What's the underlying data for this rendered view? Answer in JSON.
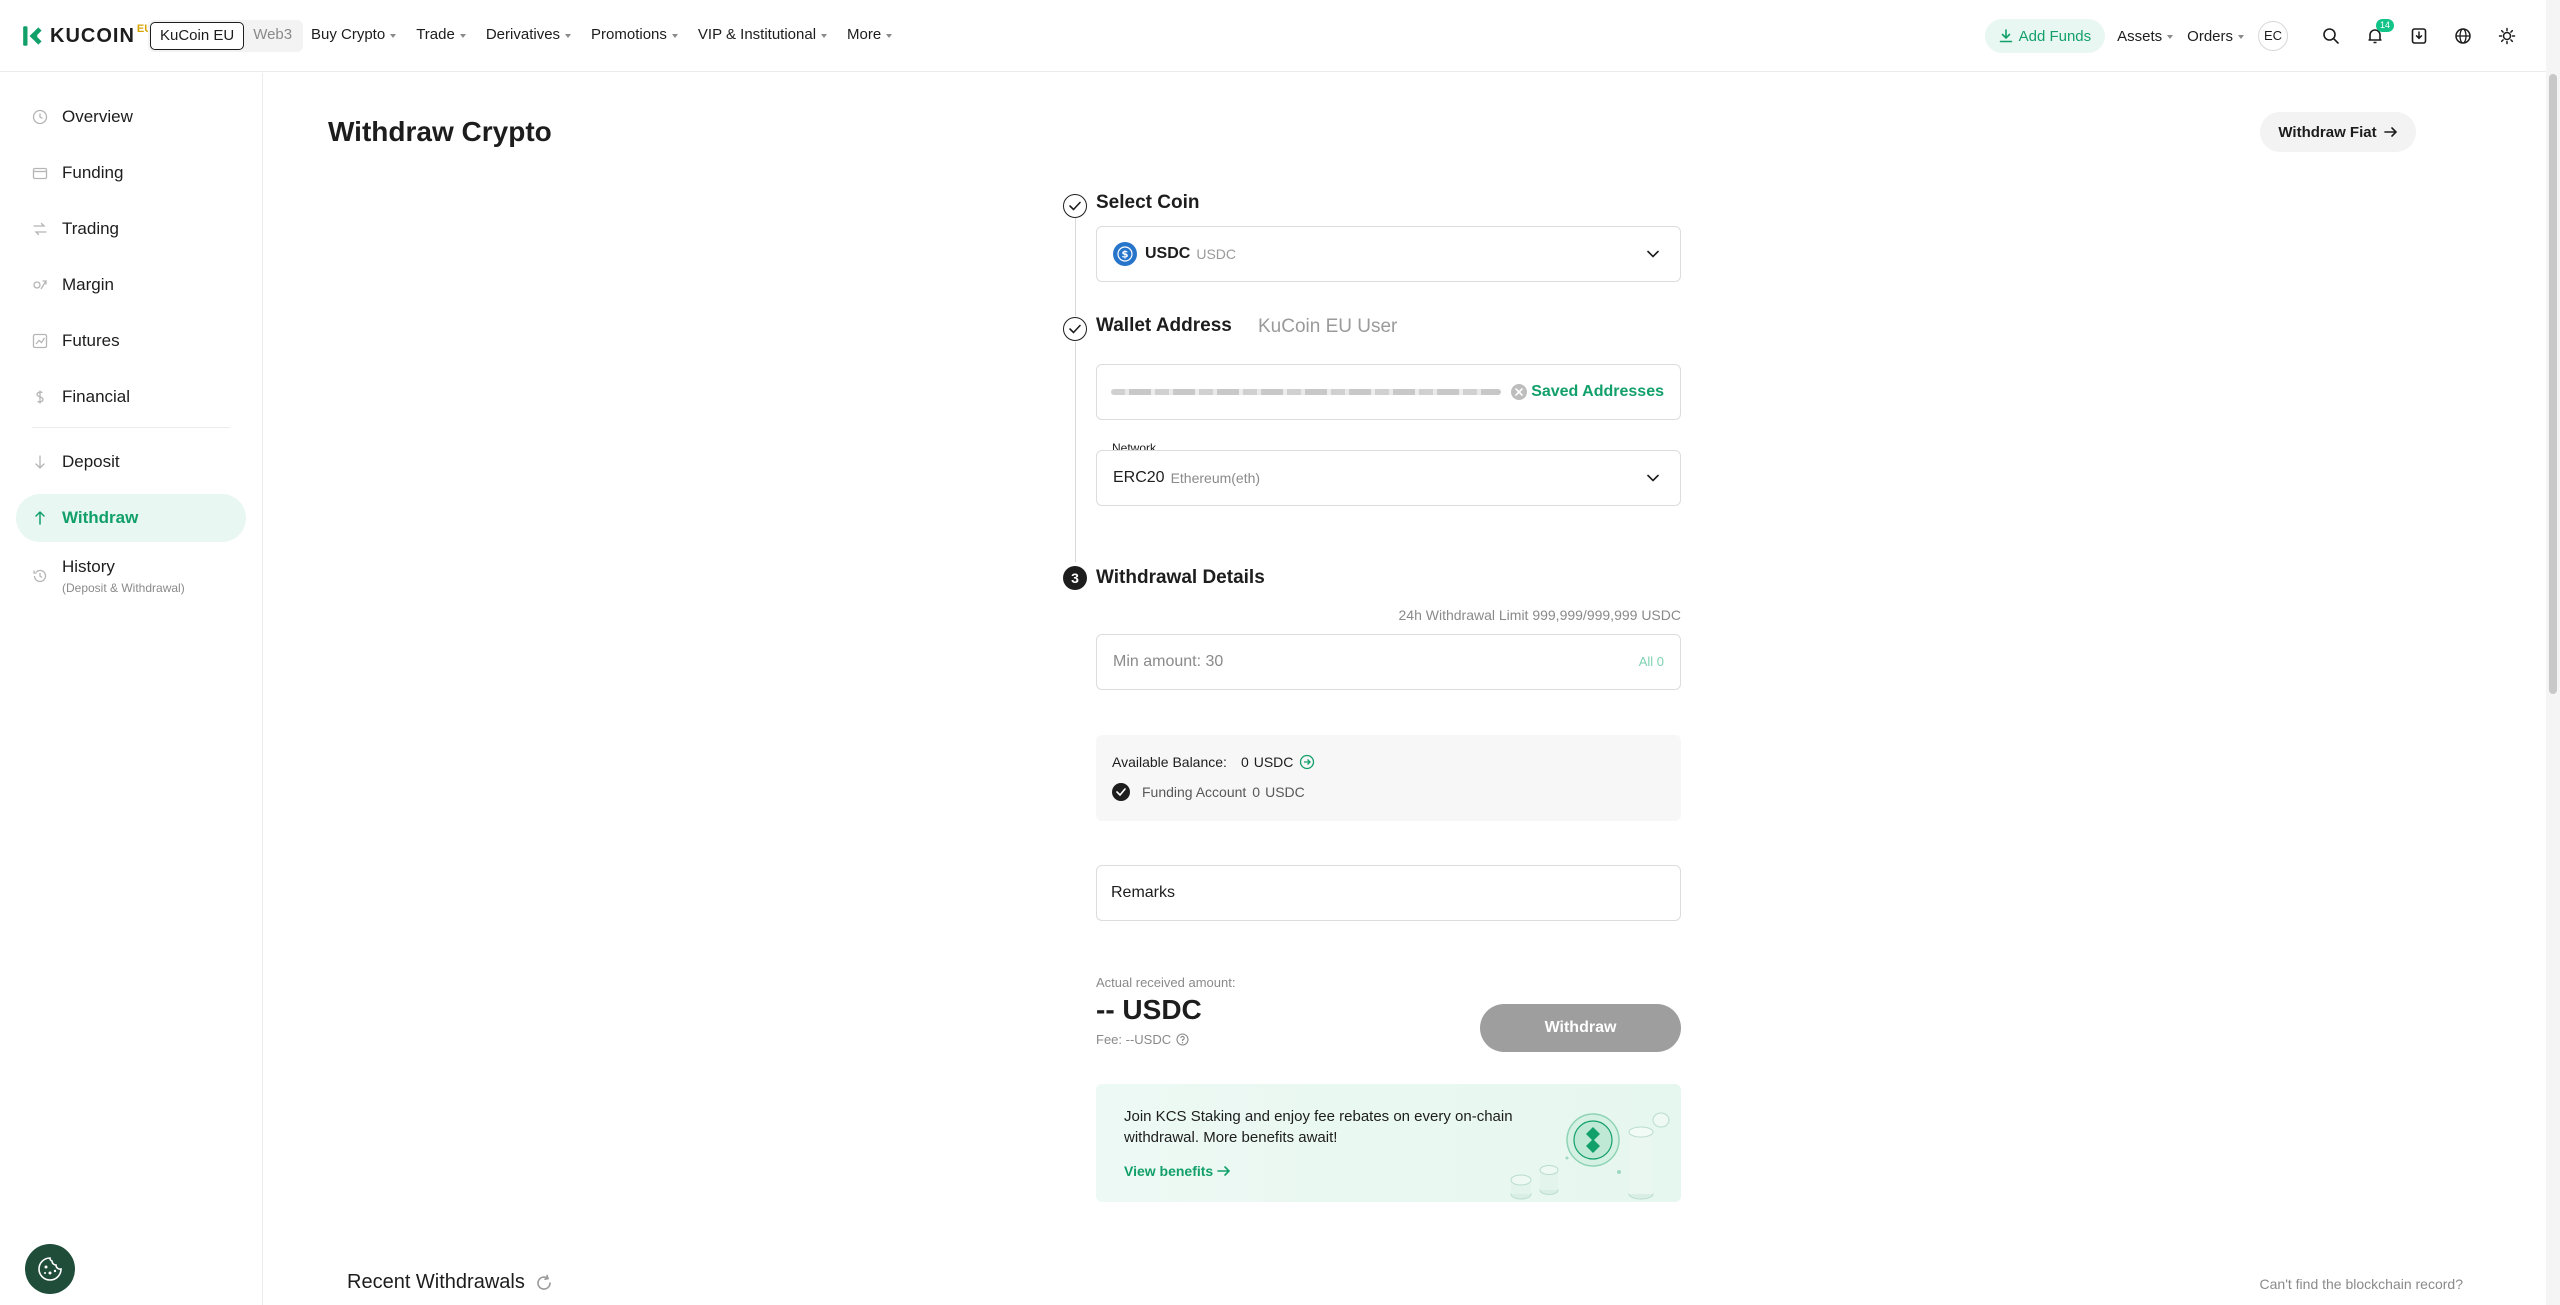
{
  "header": {
    "logo_text": "KUCOIN",
    "logo_suffix": "EU",
    "switcher": [
      "KuCoin EU",
      "Web3"
    ],
    "nav": [
      "Buy Crypto",
      "Trade",
      "Derivatives",
      "Promotions",
      "VIP & Institutional",
      "More"
    ],
    "add_funds": "Add Funds",
    "assets": "Assets",
    "orders": "Orders",
    "avatar_initials": "EC",
    "notification_count": "14"
  },
  "sidebar": {
    "items": [
      {
        "label": "Overview",
        "icon": "clock-icon"
      },
      {
        "label": "Funding",
        "icon": "wallet-icon"
      },
      {
        "label": "Trading",
        "icon": "trade-icon"
      },
      {
        "label": "Margin",
        "icon": "margin-icon"
      },
      {
        "label": "Futures",
        "icon": "chart-icon"
      },
      {
        "label": "Financial",
        "icon": "coin-icon"
      },
      {
        "label": "Deposit",
        "icon": "arrow-down-icon"
      },
      {
        "label": "Withdraw",
        "icon": "arrow-up-icon"
      },
      {
        "label": "History",
        "sub": "(Deposit & Withdrawal)",
        "icon": "history-icon"
      }
    ]
  },
  "page": {
    "title": "Withdraw Crypto",
    "withdraw_fiat": "Withdraw Fiat"
  },
  "steps": {
    "select_coin": "Select Coin",
    "wallet_address": "Wallet Address",
    "kucoin_user": "KuCoin EU User",
    "withdrawal_details": "Withdrawal Details",
    "step3_number": "3"
  },
  "coin": {
    "symbol": "USDC",
    "name": "USDC"
  },
  "address": {
    "saved_link": "Saved Addresses"
  },
  "network": {
    "label": "Network",
    "symbol": "ERC20",
    "name": "Ethereum(eth)"
  },
  "amount": {
    "limit_text": "24h Withdrawal Limit 999,999/999,999 USDC",
    "placeholder": "Min amount: 30",
    "all_label": "All 0"
  },
  "balance": {
    "available_label": "Available Balance:",
    "available_value": "0",
    "available_unit": "USDC",
    "funding_label": "Funding Account",
    "funding_value": "0",
    "funding_unit": "USDC"
  },
  "remarks": {
    "placeholder": "Remarks"
  },
  "receive": {
    "label": "Actual received amount:",
    "amount": "-- USDC",
    "fee": "Fee: --USDC",
    "withdraw_button": "Withdraw"
  },
  "promo": {
    "text": "Join KCS Staking and enjoy fee rebates on every on-chain withdrawal. More benefits await!",
    "link": "View benefits"
  },
  "recent": {
    "title": "Recent Withdrawals",
    "cant_find": "Can't find the blockchain record?"
  },
  "colors": {
    "accent": "#12a06a",
    "accent_bg": "#e8f7f1",
    "text": "#1d1d1d",
    "muted": "#8a8a8a"
  }
}
